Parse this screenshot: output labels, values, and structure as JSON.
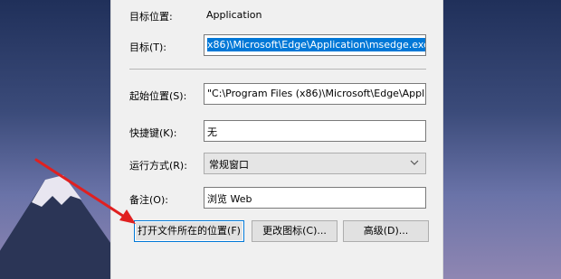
{
  "dialog": {
    "target_type_label": "目标位置:",
    "target_type_value": "Application",
    "target_label": "目标(T):",
    "target_value": "x86)\\Microsoft\\Edge\\Application\\msedge.exe\"",
    "start_in_label": "起始位置(S):",
    "start_in_value": "\"C:\\Program Files (x86)\\Microsoft\\Edge\\Applica",
    "shortcut_key_label": "快捷键(K):",
    "shortcut_key_value": "无",
    "run_label": "运行方式(R):",
    "run_value": "常规窗口",
    "comment_label": "备注(O):",
    "comment_value": "浏览 Web",
    "btn_open_location": "打开文件所在的位置(F)",
    "btn_change_icon": "更改图标(C)...",
    "btn_advanced": "高级(D)..."
  },
  "colors": {
    "selection": "#0078d7",
    "arrow": "#e02020"
  }
}
